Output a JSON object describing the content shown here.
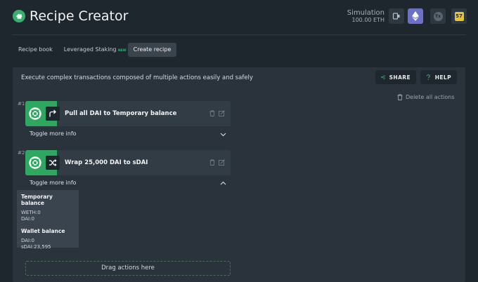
{
  "app": {
    "title": "Recipe Creator"
  },
  "simulation": {
    "label": "Simulation",
    "value": "100.00 ETH"
  },
  "header_icons": {
    "wallet": "wallet-icon",
    "eth": "ethereum-icon",
    "tx_label": "Tx",
    "notif_count": "57"
  },
  "tabs": [
    {
      "label": "Recipe book"
    },
    {
      "label": "Leveraged Staking",
      "badge": "NEW"
    },
    {
      "label": "Create recipe",
      "active": true
    }
  ],
  "panel": {
    "description": "Execute complex transactions composed of multiple actions easily and safely",
    "share_label": "SHARE",
    "help_label": "HELP",
    "delete_all_label": "Delete all actions"
  },
  "steps": [
    {
      "number": "#1",
      "title": "Pull all DAI to Temporary balance",
      "icon": "pull-arrow-icon",
      "toggle_label": "Toggle more info",
      "expanded": false
    },
    {
      "number": "#2",
      "title": "Wrap 25,000 DAI to sDAI",
      "icon": "shuffle-icon",
      "toggle_label": "Toggle more info",
      "expanded": true
    }
  ],
  "info_box": {
    "temp_heading": "Temporary balance",
    "temp_lines": [
      "WETH:0",
      "DAI:0"
    ],
    "wallet_heading": "Wallet balance",
    "wallet_lines": [
      "DAI:0",
      "sDAI:23,595"
    ]
  },
  "dropzone": {
    "label": "Drag actions here"
  },
  "colors": {
    "accent": "#2fa760",
    "background": "#1f272e",
    "panel": "#2a333b",
    "card": "#323c45",
    "eth": "#6b71c4",
    "notif": "#e8c33a"
  }
}
